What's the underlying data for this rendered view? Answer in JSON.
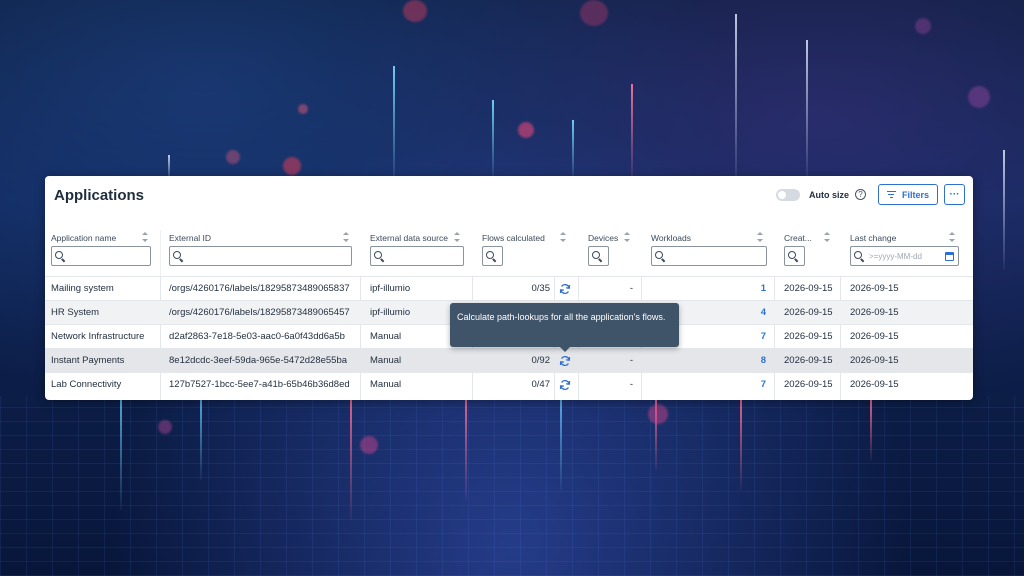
{
  "panel": {
    "title": "Applications",
    "autosize_label": "Auto size",
    "filters_label": "Filters",
    "more_label": "···"
  },
  "columns": [
    {
      "key": "app_name",
      "label": "Application name"
    },
    {
      "key": "external_id",
      "label": "External ID"
    },
    {
      "key": "source",
      "label": "External data source"
    },
    {
      "key": "flows",
      "label": "Flows calculated"
    },
    {
      "key": "devices",
      "label": "Devices"
    },
    {
      "key": "workloads",
      "label": "Workloads"
    },
    {
      "key": "created",
      "label": "Creat..."
    },
    {
      "key": "last_change",
      "label": "Last change"
    }
  ],
  "filters": {
    "last_change_placeholder": ">=yyyy-MM-dd"
  },
  "rows": [
    {
      "app_name": "Mailing system",
      "external_id": "/orgs/4260176/labels/18295873489065837",
      "source": "ipf-illumio",
      "flows": "0/35",
      "devices": "-",
      "workloads": "1",
      "created": "2026-09-15",
      "last_change": "2026-09-15"
    },
    {
      "app_name": "HR System",
      "external_id": "/orgs/4260176/labels/18295873489065457",
      "source": "ipf-illumio",
      "flows": "",
      "devices": "",
      "workloads": "4",
      "created": "2026-09-15",
      "last_change": "2026-09-15"
    },
    {
      "app_name": "Network Infrastructure",
      "external_id": "d2af2863-7e18-5e03-aac0-6a0f43dd6a5b",
      "source": "Manual",
      "flows": "",
      "devices": "",
      "workloads": "7",
      "created": "2026-09-15",
      "last_change": "2026-09-15"
    },
    {
      "app_name": "Instant Payments",
      "external_id": "8e12dcdc-3eef-59da-965e-5472d28e55ba",
      "source": "Manual",
      "flows": "0/92",
      "devices": "-",
      "workloads": "8",
      "created": "2026-09-15",
      "last_change": "2026-09-15"
    },
    {
      "app_name": "Lab Connectivity",
      "external_id": "127b7527-1bcc-5ee7-a41b-65b46b36d8ed",
      "source": "Manual",
      "flows": "0/47",
      "devices": "-",
      "workloads": "7",
      "created": "2026-09-15",
      "last_change": "2026-09-15"
    }
  ],
  "tooltip": {
    "text": "Calculate path-lookups for all the application's flows."
  },
  "icons": {
    "help": "question-circle-icon",
    "filters": "filter-lines-icon",
    "search": "magnifier-icon",
    "calendar": "calendar-icon",
    "refresh": "refresh-icon",
    "sort": "sort-arrows-icon"
  },
  "colors": {
    "accent": "#2e6fd3",
    "tooltip_bg": "#3f5468",
    "panel_bg": "#ffffff"
  }
}
